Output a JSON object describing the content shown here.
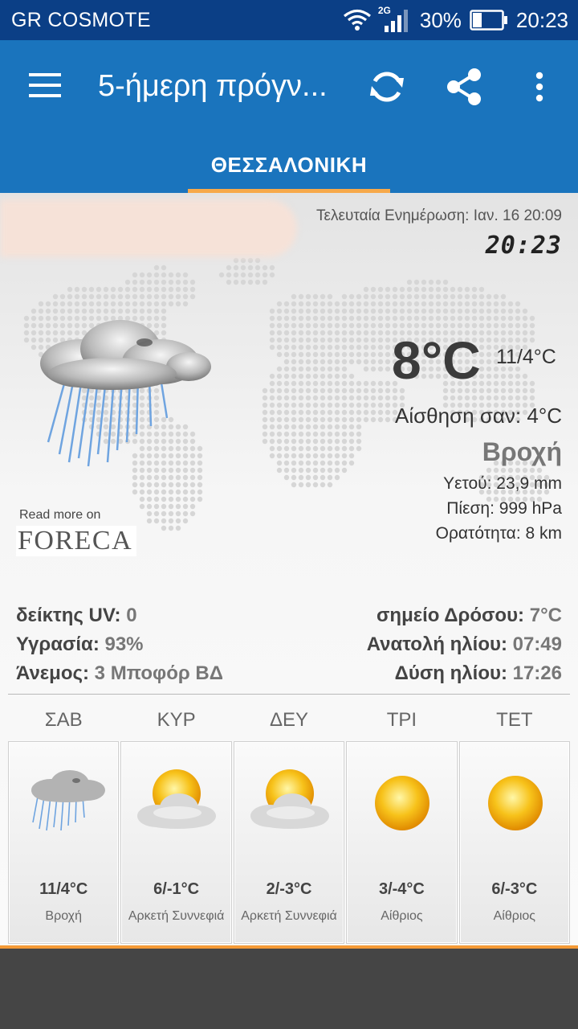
{
  "status_bar": {
    "carrier": "GR COSMOTE",
    "network": "2G",
    "battery": "30%",
    "time": "20:23"
  },
  "app_bar": {
    "title": "5-ήμερη πρόγν...",
    "menu_icon": "hamburger-menu-icon",
    "refresh_icon": "refresh-icon",
    "share_icon": "share-icon",
    "overflow_icon": "more-vert-icon",
    "tab": "ΘΕΣΣΑΛΟΝΙΚΗ",
    "accent": "#f7a94a",
    "color": "#1a74bd"
  },
  "current": {
    "last_update": "Τελευταία Ενημέρωση: Ιαν. 16  20:09",
    "clock": "20:23",
    "temp": "8°C",
    "hilo": "11/4°C",
    "feels_like": "Αίσθηση σαν: 4°C",
    "condition": "Βροχή",
    "precip": "Υετού: 23,9 mm",
    "pressure": "Πίεση: 999 hPa",
    "visibility": "Ορατότητα: 8 km",
    "icon": "rain-cloud-icon"
  },
  "foreca": {
    "read_more": "Read more on",
    "logo": "FORECA"
  },
  "stats": {
    "uv_label": "δείκτης UV:",
    "uv_value": "0",
    "humidity_label": "Υγρασία:",
    "humidity_value": "93%",
    "wind_label": "Άνεμος:",
    "wind_value": "3 Μποφόρ ΒΔ",
    "dew_label": "σημείο Δρόσου:",
    "dew_value": "7°C",
    "sunrise_label": "Ανατολή ηλίου:",
    "sunrise_value": "07:49",
    "sunset_label": "Δύση ηλίου:",
    "sunset_value": "17:26"
  },
  "forecast": [
    {
      "day": "ΣΑΒ",
      "temp": "11/4°C",
      "cond": "Βροχή",
      "icon": "rain-cloud-icon"
    },
    {
      "day": "ΚΥΡ",
      "temp": "6/-1°C",
      "cond": "Αρκετή Συννεφιά",
      "icon": "partly-cloudy-icon"
    },
    {
      "day": "ΔΕΥ",
      "temp": "2/-3°C",
      "cond": "Αρκετή Συννεφιά",
      "icon": "partly-cloudy-icon"
    },
    {
      "day": "ΤΡΙ",
      "temp": "3/-4°C",
      "cond": "Αίθριος",
      "icon": "sun-icon"
    },
    {
      "day": "ΤΕΤ",
      "temp": "6/-3°C",
      "cond": "Αίθριος",
      "icon": "sun-icon"
    }
  ]
}
